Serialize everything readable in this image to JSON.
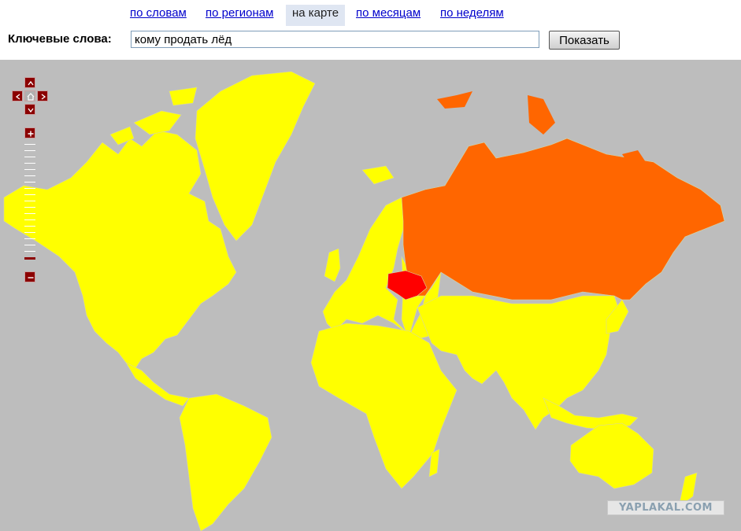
{
  "tabs": [
    {
      "label": "по словам",
      "active": false
    },
    {
      "label": "по регионам",
      "active": false
    },
    {
      "label": "на карте",
      "active": true
    },
    {
      "label": "по месяцам",
      "active": false
    },
    {
      "label": "по неделям",
      "active": false
    }
  ],
  "search": {
    "label": "Ключевые слова:",
    "value": "кому продать лёд",
    "button_label": "Показать"
  },
  "map": {
    "colors": {
      "ocean": "#bdbdbd",
      "low": "#ffff00",
      "medium": "#ff6600",
      "high": "#ff0000"
    },
    "highlighted_regions": [
      {
        "name_icon": "russia-region",
        "level": "medium"
      },
      {
        "name_icon": "ukraine-region",
        "level": "high"
      }
    ],
    "controls": {
      "pan_icons": [
        "pan-up-icon",
        "pan-left-icon",
        "home-icon",
        "pan-right-icon",
        "pan-down-icon"
      ],
      "zoom_in_icon": "plus-icon",
      "zoom_out_icon": "minus-icon"
    }
  },
  "watermark": {
    "text": "YAPLAKAL.COM"
  }
}
